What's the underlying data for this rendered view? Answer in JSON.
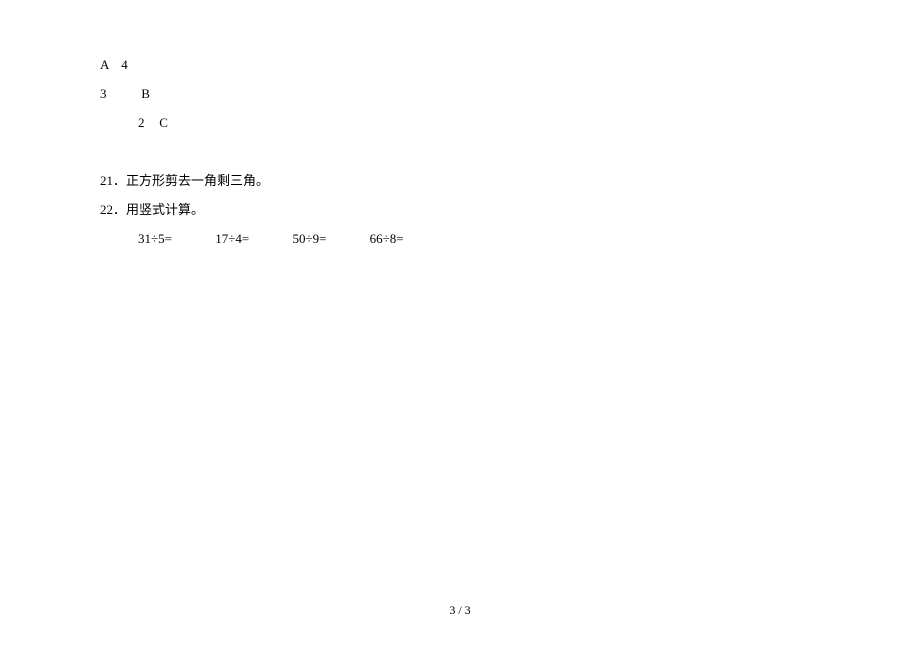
{
  "answers": {
    "a": "A",
    "a_value": "4",
    "three": "3",
    "b": "B",
    "two": "2",
    "c": "C"
  },
  "questions": {
    "q21": {
      "number": "21．",
      "text": "正方形剪去一角剩三角。"
    },
    "q22": {
      "number": "22．",
      "text": "用竖式计算。",
      "equations": {
        "e1": "31÷5=",
        "e2": "17÷4=",
        "e3": "50÷9=",
        "e4": "66÷8="
      }
    }
  },
  "page": {
    "number": "3 / 3"
  }
}
